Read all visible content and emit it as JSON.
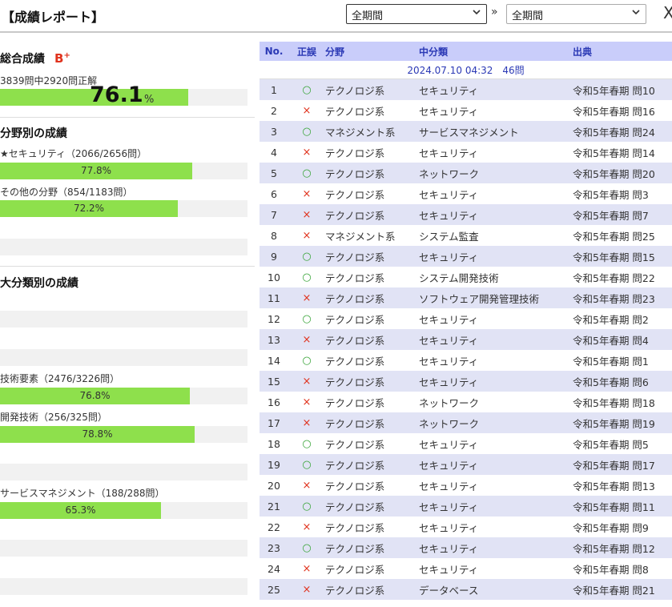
{
  "header": {
    "title": "【成績レポート】",
    "period_from": "全期間",
    "period_to": "全期間",
    "arrow": "»",
    "close": "X"
  },
  "overall": {
    "title": "総合成績",
    "grade": "B",
    "grade_sup": "+",
    "summary": "3839問中2920問正解",
    "percent": "76.1",
    "percent_sign": "%",
    "fill": 0.761
  },
  "fields": {
    "title": "分野別の成績",
    "items": [
      {
        "label": "★セキュリティ（2066/2656問）",
        "value": "77.8%",
        "fill": 0.778
      },
      {
        "label": "その他の分野（854/1183問）",
        "value": "72.2%",
        "fill": 0.722
      }
    ]
  },
  "major": {
    "title": "大分類別の成績",
    "items": [
      {
        "label": "技術要素（2476/3226問）",
        "value": "76.8%",
        "fill": 0.768
      },
      {
        "label": "開発技術（256/325問）",
        "value": "78.8%",
        "fill": 0.788
      },
      {
        "label": "サービスマネジメント（188/288問）",
        "value": "65.3%",
        "fill": 0.653
      }
    ]
  },
  "table": {
    "headers": [
      "No.",
      "正誤",
      "分野",
      "中分類",
      "出典"
    ],
    "session": "2024.07.10 04:32　46問",
    "rows": [
      {
        "no": "1",
        "mark": "ok",
        "field": "テクノロジ系",
        "sub": "セキュリティ",
        "src": "令和5年春期 問10"
      },
      {
        "no": "2",
        "mark": "ng",
        "field": "テクノロジ系",
        "sub": "セキュリティ",
        "src": "令和5年春期 問16"
      },
      {
        "no": "3",
        "mark": "ok",
        "field": "マネジメント系",
        "sub": "サービスマネジメント",
        "src": "令和5年春期 問24"
      },
      {
        "no": "4",
        "mark": "ng",
        "field": "テクノロジ系",
        "sub": "セキュリティ",
        "src": "令和5年春期 問14"
      },
      {
        "no": "5",
        "mark": "ok",
        "field": "テクノロジ系",
        "sub": "ネットワーク",
        "src": "令和5年春期 問20"
      },
      {
        "no": "6",
        "mark": "ng",
        "field": "テクノロジ系",
        "sub": "セキュリティ",
        "src": "令和5年春期 問3"
      },
      {
        "no": "7",
        "mark": "ng",
        "field": "テクノロジ系",
        "sub": "セキュリティ",
        "src": "令和5年春期 問7"
      },
      {
        "no": "8",
        "mark": "ng",
        "field": "マネジメント系",
        "sub": "システム監査",
        "src": "令和5年春期 問25"
      },
      {
        "no": "9",
        "mark": "ok",
        "field": "テクノロジ系",
        "sub": "セキュリティ",
        "src": "令和5年春期 問15"
      },
      {
        "no": "10",
        "mark": "ok",
        "field": "テクノロジ系",
        "sub": "システム開発技術",
        "src": "令和5年春期 問22"
      },
      {
        "no": "11",
        "mark": "ng",
        "field": "テクノロジ系",
        "sub": "ソフトウェア開発管理技術",
        "src": "令和5年春期 問23"
      },
      {
        "no": "12",
        "mark": "ok",
        "field": "テクノロジ系",
        "sub": "セキュリティ",
        "src": "令和5年春期 問2"
      },
      {
        "no": "13",
        "mark": "ng",
        "field": "テクノロジ系",
        "sub": "セキュリティ",
        "src": "令和5年春期 問4"
      },
      {
        "no": "14",
        "mark": "ok",
        "field": "テクノロジ系",
        "sub": "セキュリティ",
        "src": "令和5年春期 問1"
      },
      {
        "no": "15",
        "mark": "ng",
        "field": "テクノロジ系",
        "sub": "セキュリティ",
        "src": "令和5年春期 問6"
      },
      {
        "no": "16",
        "mark": "ng",
        "field": "テクノロジ系",
        "sub": "ネットワーク",
        "src": "令和5年春期 問18"
      },
      {
        "no": "17",
        "mark": "ng",
        "field": "テクノロジ系",
        "sub": "ネットワーク",
        "src": "令和5年春期 問19"
      },
      {
        "no": "18",
        "mark": "ok",
        "field": "テクノロジ系",
        "sub": "セキュリティ",
        "src": "令和5年春期 問5"
      },
      {
        "no": "19",
        "mark": "ok",
        "field": "テクノロジ系",
        "sub": "セキュリティ",
        "src": "令和5年春期 問17"
      },
      {
        "no": "20",
        "mark": "ng",
        "field": "テクノロジ系",
        "sub": "セキュリティ",
        "src": "令和5年春期 問13"
      },
      {
        "no": "21",
        "mark": "ok",
        "field": "テクノロジ系",
        "sub": "セキュリティ",
        "src": "令和5年春期 問11"
      },
      {
        "no": "22",
        "mark": "ng",
        "field": "テクノロジ系",
        "sub": "セキュリティ",
        "src": "令和5年春期 問9"
      },
      {
        "no": "23",
        "mark": "ok",
        "field": "テクノロジ系",
        "sub": "セキュリティ",
        "src": "令和5年春期 問12"
      },
      {
        "no": "24",
        "mark": "ng",
        "field": "テクノロジ系",
        "sub": "セキュリティ",
        "src": "令和5年春期 問8"
      },
      {
        "no": "25",
        "mark": "ng",
        "field": "テクノロジ系",
        "sub": "データベース",
        "src": "令和5年春期 問21"
      }
    ],
    "marks": {
      "ok": "○",
      "ng": "×"
    }
  },
  "colors": {
    "accent": "#2b39b5",
    "bar": "#8ee04c",
    "ok": "#3aa53a",
    "ng": "#e0321d",
    "header_bg": "#c9cdfa"
  }
}
